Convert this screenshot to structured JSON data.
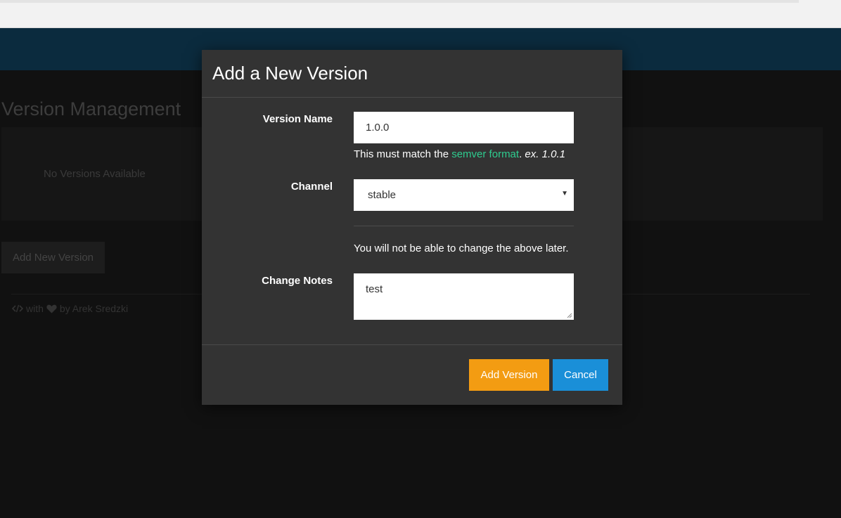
{
  "page": {
    "title": "Version Management",
    "empty_message": "No Versions Available",
    "add_button_label": "Add New Version",
    "footer": {
      "code_icon": "code-icon",
      "with_text": "with",
      "heart_icon": "heart-icon",
      "by_text": "by Arek Sredzki"
    }
  },
  "modal": {
    "title": "Add a New Version",
    "version_name": {
      "label": "Version Name",
      "value": "1.0.0",
      "help_prefix": "This must match the ",
      "help_link": "semver format",
      "help_suffix": ". ",
      "help_example": "ex. 1.0.1"
    },
    "channel": {
      "label": "Channel",
      "selected": "stable",
      "arrow_icon": "caret-down-icon"
    },
    "warning": "You will not be able to change the above later.",
    "change_notes": {
      "label": "Change Notes",
      "value": "test"
    },
    "buttons": {
      "submit": "Add Version",
      "cancel": "Cancel"
    }
  },
  "colors": {
    "topbar": "#0b2b3e",
    "modal_bg": "#333333",
    "link": "#2ecc8f",
    "primary": "#f39c12",
    "cancel": "#1a8fd8"
  }
}
